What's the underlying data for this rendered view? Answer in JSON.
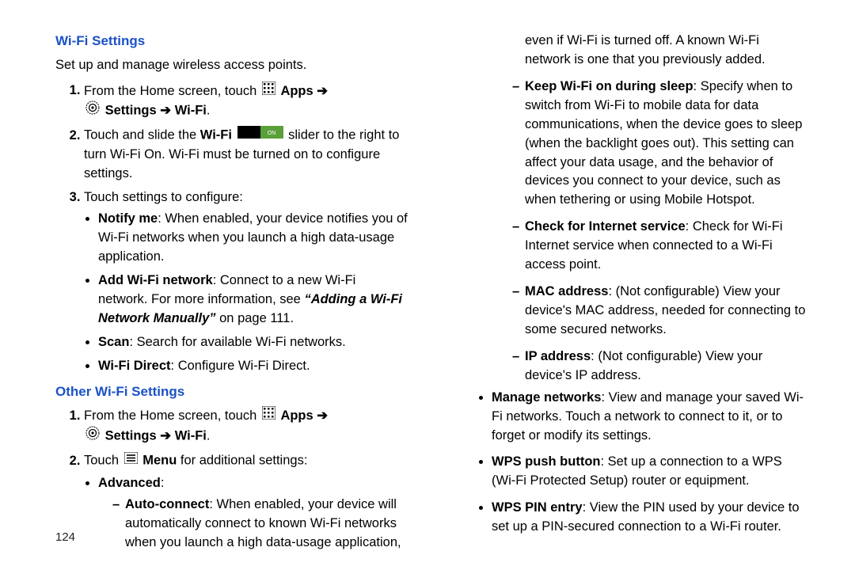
{
  "h1": "Wi-Fi Settings",
  "lead": "Set up and manage wireless access points.",
  "s1_a": "From the Home screen, touch ",
  "apps": "Apps",
  "arrow": "➔",
  "settings": "Settings",
  "wifi": "Wi-Fi",
  "s2_a": "Touch and slide the ",
  "s2_b": " slider to the right to turn Wi-Fi On. Wi-Fi must be turned on to configure settings.",
  "s3": "Touch settings to configure:",
  "nm_t": "Notify me",
  "nm_d": ": When enabled, your device notifies you of Wi-Fi networks when you launch a high data-usage application.",
  "aw_t": "Add Wi-Fi network",
  "aw_d1": ": Connect to a new Wi-Fi network. For more information, see ",
  "aw_link": "“Adding a Wi-Fi Network Manually”",
  "aw_d2": " on page 111.",
  "sc_t": "Scan",
  "sc_d": ": Search for available Wi-Fi networks.",
  "wd_t": "Wi-Fi Direct",
  "wd_d": ": Configure Wi-Fi Direct.",
  "h2": "Other Wi-Fi Settings",
  "o1": "From the Home screen, touch ",
  "o2a": "Touch ",
  "o2b": "Menu",
  "o2c": " for additional settings:",
  "adv": "Advanced",
  "ac_t": "Auto-connect",
  "ac_d": ": When enabled, your device will automatically connect to known Wi-Fi networks when you launch a high data-usage application, even if Wi-Fi is turned off. A known Wi-Fi network is one that you previously added.",
  "kw_t": "Keep Wi-Fi on during sleep",
  "kw_d": ": Specify when to switch from Wi-Fi to mobile data for data communications, when the device goes to sleep (when the backlight goes out). This setting can affect your data usage, and the behavior of devices you connect to your device, such as when tethering or using Mobile Hotspot.",
  "ci_t": "Check for Internet service",
  "ci_d": ": Check for Wi-Fi Internet service when connected to a Wi-Fi access point.",
  "ma_t": "MAC address",
  "ma_d": ": (Not configurable) View your device's MAC address, needed for connecting to some secured networks.",
  "ip_t": "IP address",
  "ip_d": ": (Not configurable) View your device's IP address.",
  "mn_t": "Manage networks",
  "mn_d": ": View and manage your saved Wi-Fi networks. Touch a network to connect to it, or to forget or modify its settings.",
  "wp_t": "WPS push button",
  "wp_d": ": Set up a connection to a WPS (Wi-Fi Protected Setup) router or equipment.",
  "we_t": "WPS PIN entry",
  "we_d": ": View the PIN used by your device to set up a PIN-secured connection to a Wi-Fi router.",
  "page": "124"
}
